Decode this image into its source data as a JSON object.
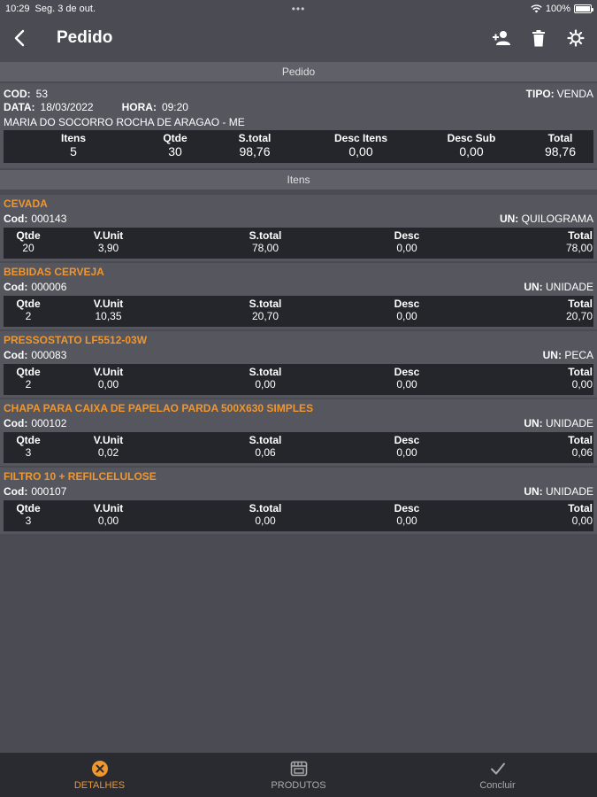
{
  "status": {
    "time": "10:29",
    "date": "Seg. 3 de out.",
    "dots": "•••",
    "battery": "100%"
  },
  "nav": {
    "title": "Pedido"
  },
  "sections": {
    "pedido": "Pedido",
    "itens": "Itens"
  },
  "order": {
    "cod_label": "COD:",
    "cod": "53",
    "tipo_label": "TIPO:",
    "tipo": "VENDA",
    "data_label": "DATA:",
    "data": "18/03/2022",
    "hora_label": "HORA:",
    "hora": "09:20",
    "cliente": "MARIA DO SOCORRO ROCHA DE ARAGAO - ME",
    "totals": [
      {
        "label": "Itens",
        "value": "5"
      },
      {
        "label": "Qtde",
        "value": "30"
      },
      {
        "label": "S.total",
        "value": "98,76"
      },
      {
        "label": "Desc Itens",
        "value": "0,00"
      },
      {
        "label": "Desc Sub",
        "value": "0,00"
      },
      {
        "label": "Total",
        "value": "98,76"
      }
    ]
  },
  "columns": {
    "qtde": "Qtde",
    "vunit": "V.Unit",
    "stotal": "S.total",
    "desc": "Desc",
    "total": "Total"
  },
  "labels": {
    "cod": "Cod:",
    "un": "UN:"
  },
  "items": [
    {
      "name": "CEVADA",
      "cod": "000143",
      "un": "QUILOGRAMA",
      "qtde": "20",
      "vunit": "3,90",
      "stotal": "78,00",
      "desc": "0,00",
      "total": "78,00"
    },
    {
      "name": "BEBIDAS CERVEJA",
      "cod": "000006",
      "un": "UNIDADE",
      "qtde": "2",
      "vunit": "10,35",
      "stotal": "20,70",
      "desc": "0,00",
      "total": "20,70"
    },
    {
      "name": "PRESSOSTATO LF5512-03W",
      "cod": "000083",
      "un": "PECA",
      "qtde": "2",
      "vunit": "0,00",
      "stotal": "0,00",
      "desc": "0,00",
      "total": "0,00"
    },
    {
      "name": "CHAPA PARA CAIXA DE PAPELAO PARDA 500X630 SIMPLES",
      "cod": "000102",
      "un": "UNIDADE",
      "qtde": "3",
      "vunit": "0,02",
      "stotal": "0,06",
      "desc": "0,00",
      "total": "0,06"
    },
    {
      "name": "FILTRO 10 + REFILCELULOSE",
      "cod": "000107",
      "un": "UNIDADE",
      "qtde": "3",
      "vunit": "0,00",
      "stotal": "0,00",
      "desc": "0,00",
      "total": "0,00"
    }
  ],
  "tabs": {
    "detalhes": "DETALHES",
    "produtos": "PRODUTOS",
    "concluir": "Concluir"
  },
  "colors": {
    "accent": "#f0962e",
    "background": "#4a4b53",
    "panel": "#55565e",
    "dark": "#25262c"
  }
}
